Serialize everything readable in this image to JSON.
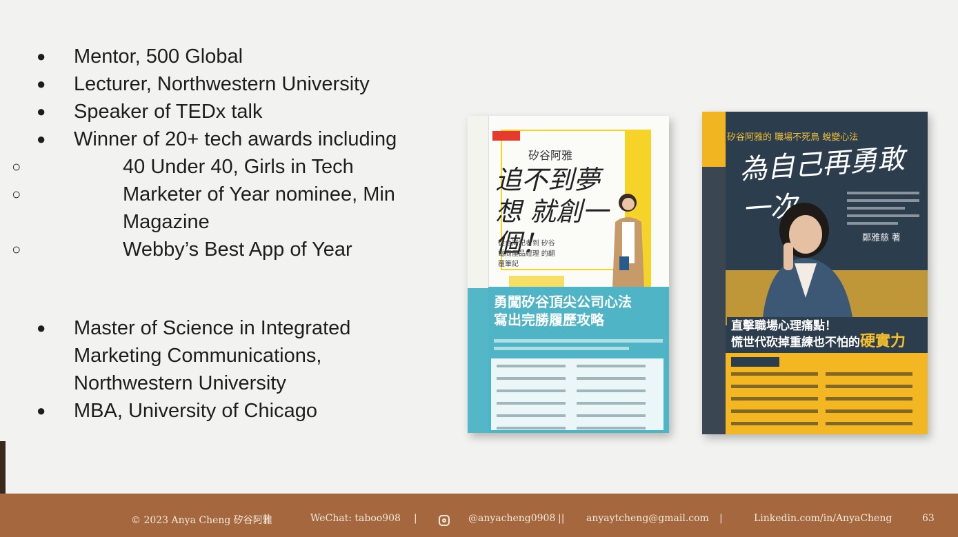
{
  "bullets_top": [
    "Mentor, 500 Global",
    "Lecturer, Northwestern University",
    "Speaker of TEDx talk",
    "Winner of 20+ tech awards including"
  ],
  "sub_bullets": [
    "40 Under 40, Girls in Tech",
    "Marketer of Year nominee, Min Magazine",
    "Webby’s Best App of Year"
  ],
  "bullets_bottom": [
    "Master of Science in Integrated Marketing Communications, Northwestern University",
    "MBA, University of Chicago"
  ],
  "book1": {
    "author": "矽谷阿雅",
    "title": "追不到夢想 就創一個！",
    "subtitle": "從台灣記者到 矽谷電商產品經理 的翻覆筆記",
    "band_title": "勇闖矽谷頂尖公司心法 寫出完勝履歷攻略",
    "colors": {
      "band": "#4fb5c6",
      "accent": "#f5d328"
    }
  },
  "book2": {
    "top_line": "矽谷阿雅的 職場不死鳥 蛻變心法",
    "title": "為自己再勇敢一次",
    "author": "鄭雅慈 著",
    "slogan_line1": "直擊職場心理痛點！",
    "slogan_line2_prefix": "慌世代砍掉重練也不怕的",
    "slogan_emphasis": "硬實力",
    "colors": {
      "cover": "#2c3d4e",
      "accent": "#f2b722"
    }
  },
  "footer": {
    "copyright": "© 2023 Anya Cheng 矽谷阿雅",
    "wechat": "WeChat: taboo908",
    "instagram": "@anyacheng0908",
    "email": "anyaytcheng@gmail.com",
    "linkedin": "Linkedin.com/in/AnyaCheng",
    "page_number": "63",
    "color": "#a5673d"
  }
}
